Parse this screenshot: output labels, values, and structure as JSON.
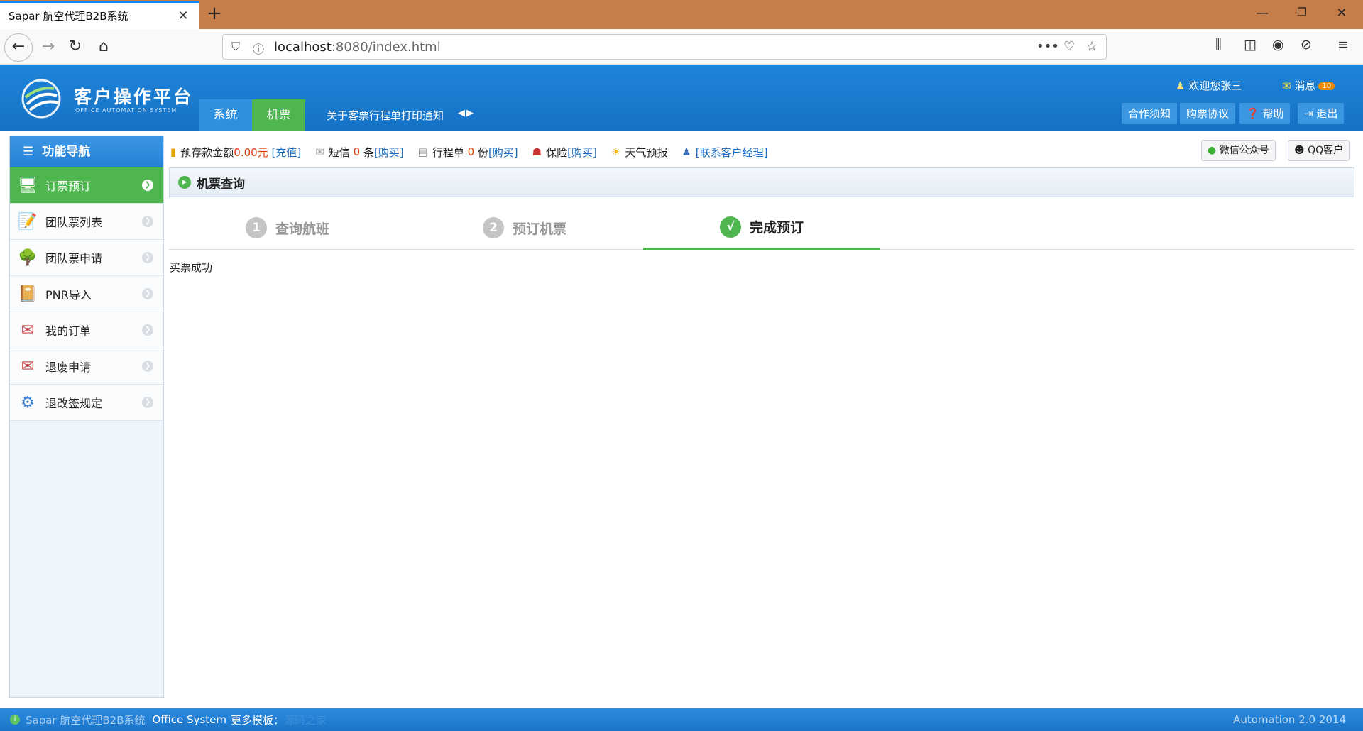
{
  "browser": {
    "tab_title": "Sapar 航空代理B2B系统",
    "tab_close": "✕",
    "new_tab": "+",
    "url_host": "localhost",
    "url_rest": ":8080/index.html",
    "window_min": "—",
    "window_restore": "❐",
    "window_close": "✕",
    "icons": [
      "back-icon",
      "forward-icon",
      "reload-icon",
      "home-icon",
      "shield-icon",
      "info-icon",
      "more-icon",
      "pocket-icon",
      "star-icon",
      "library-icon",
      "sidebar-icon",
      "account-icon",
      "extension-icon",
      "menu-icon"
    ]
  },
  "header": {
    "logo_title": "客户操作平台",
    "logo_subtitle": "OFFICE AUTOMATION SYSTEM",
    "nav": [
      {
        "label": "系统",
        "active": false
      },
      {
        "label": "机票",
        "active": true
      }
    ],
    "notice": "关于客票行程单打印通知",
    "notice_arrows": "◀▶",
    "welcome": "欢迎您张三",
    "message_label": "消息",
    "message_count": "10",
    "buttons": {
      "cooperation": "合作须知",
      "agreement": "购票协议",
      "help": "帮助",
      "logout": "退出"
    }
  },
  "sidebar": {
    "title": "功能导航",
    "items": [
      {
        "label": "订票预订",
        "icon": "monitor-icon",
        "active": true
      },
      {
        "label": "团队票列表",
        "icon": "notepad-icon",
        "active": false
      },
      {
        "label": "团队票申请",
        "icon": "tree-icon",
        "active": false
      },
      {
        "label": "PNR导入",
        "icon": "book-icon",
        "active": false
      },
      {
        "label": "我的订单",
        "icon": "envelope-icon",
        "active": false
      },
      {
        "label": "退废申请",
        "icon": "envelope-icon",
        "active": false
      },
      {
        "label": "退改签规定",
        "icon": "gears-icon",
        "active": false
      }
    ]
  },
  "infobar": {
    "deposit_label": "预存款金额",
    "deposit_value": "0.00元",
    "deposit_link": "[充值]",
    "sms_label": "短信",
    "sms_count": "0",
    "sms_unit": "条",
    "sms_link": "[购买]",
    "itinerary_label": "行程单",
    "itinerary_count": "0",
    "itinerary_unit": "份",
    "itinerary_link": "[购买]",
    "insurance_label": "保险",
    "insurance_link": "[购买]",
    "weather_label": "天气预报",
    "manager_link": "[联系客户经理]",
    "wechat_label": "微信公众号",
    "qq_label": "QQ客户"
  },
  "panel": {
    "title": "机票查询",
    "steps": [
      {
        "num": "1",
        "label": "查询航班",
        "done": false
      },
      {
        "num": "2",
        "label": "预订机票",
        "done": false
      },
      {
        "num": "√",
        "label": "完成预订",
        "done": true
      }
    ],
    "result_text": "买票成功"
  },
  "footer": {
    "system_name": "Sapar 航空代理B2B系统",
    "office": "Office System",
    "more_templates": "更多模板：",
    "more_link": "源码之家",
    "version": "Automation 2.0 2014"
  },
  "colors": {
    "header_blue": "#1f84d8",
    "accent_green": "#4fb54f",
    "tab_bar": "#c57d4a",
    "price_red": "#e03c00",
    "link_blue": "#1a6dc2"
  }
}
